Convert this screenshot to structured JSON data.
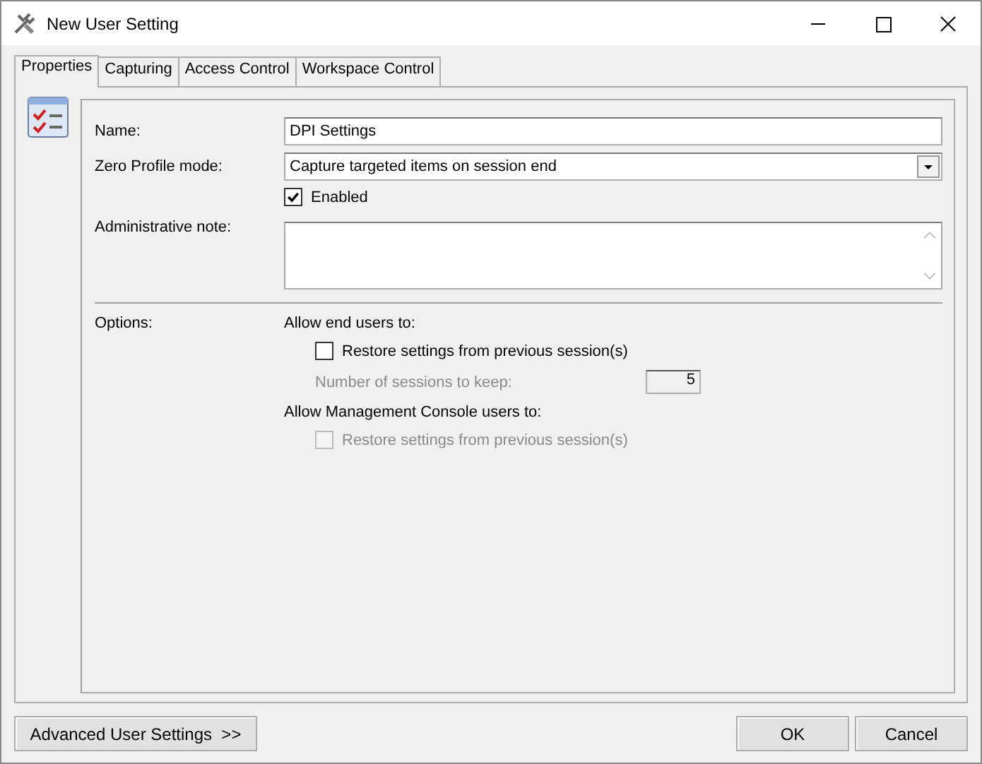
{
  "window": {
    "title": "New User Setting"
  },
  "tabs": [
    {
      "label": "Properties",
      "selected": true
    },
    {
      "label": "Capturing",
      "selected": false
    },
    {
      "label": "Access Control",
      "selected": false
    },
    {
      "label": "Workspace Control",
      "selected": false
    }
  ],
  "form": {
    "name_label": "Name:",
    "name_value": "DPI Settings",
    "mode_label": "Zero Profile mode:",
    "mode_value": "Capture targeted items on session end",
    "enabled": {
      "label": "Enabled",
      "checked": true
    },
    "note_label": "Administrative note:"
  },
  "options": {
    "label": "Options:",
    "end_users_heading": "Allow end users to:",
    "end_users_restore": {
      "label": "Restore settings from previous session(s)",
      "checked": false,
      "disabled": false
    },
    "sessions_label": "Number of sessions to keep:",
    "sessions_value": "5",
    "sessions_disabled": true,
    "console_heading": "Allow Management Console users to:",
    "console_restore": {
      "label": "Restore settings from previous session(s)",
      "checked": false,
      "disabled": true
    }
  },
  "buttons": {
    "advanced": "Advanced User Settings  >>",
    "ok": "OK",
    "cancel": "Cancel"
  }
}
